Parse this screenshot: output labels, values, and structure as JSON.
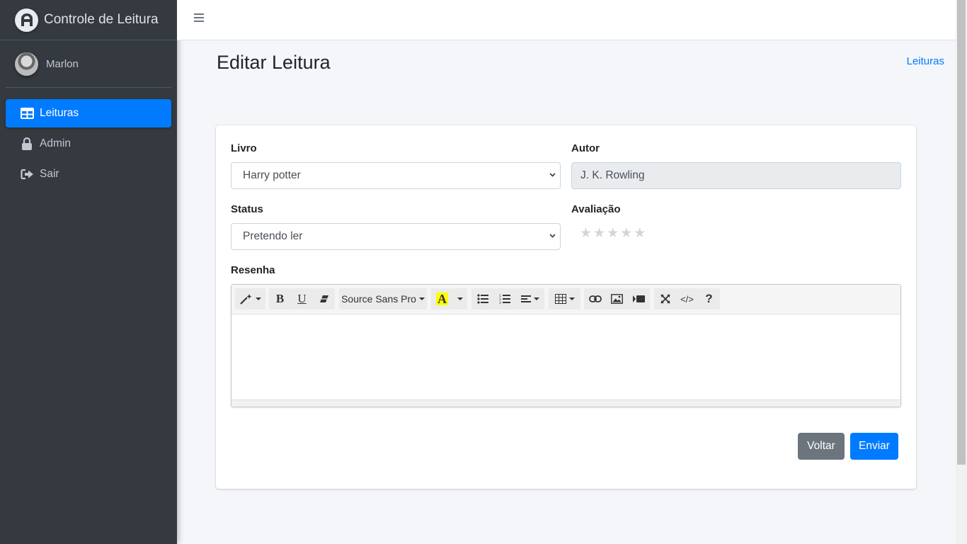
{
  "app": {
    "title": "Controle de Leitura"
  },
  "user": {
    "name": "Marlon"
  },
  "sidebar": {
    "items": [
      {
        "label": "Leituras",
        "icon": "table-icon",
        "active": true
      },
      {
        "label": "Admin",
        "icon": "lock-icon",
        "active": false
      },
      {
        "label": "Sair",
        "icon": "sign-out-icon",
        "active": false
      }
    ]
  },
  "page": {
    "title": "Editar Leitura",
    "breadcrumb": "Leituras"
  },
  "form": {
    "livro": {
      "label": "Livro",
      "value": "Harry potter"
    },
    "autor": {
      "label": "Autor",
      "value": "J. K. Rowling"
    },
    "status": {
      "label": "Status",
      "value": "Pretendo ler"
    },
    "avaliacao": {
      "label": "Avaliação",
      "rating": 0,
      "max": 5
    },
    "resenha": {
      "label": "Resenha",
      "font_name": "Source Sans Pro",
      "content": ""
    }
  },
  "actions": {
    "back_label": "Voltar",
    "submit_label": "Enviar"
  },
  "colors": {
    "primary": "#007bff",
    "secondary": "#6c757d",
    "sidebar": "#343a40",
    "highlight": "#ffff00"
  }
}
